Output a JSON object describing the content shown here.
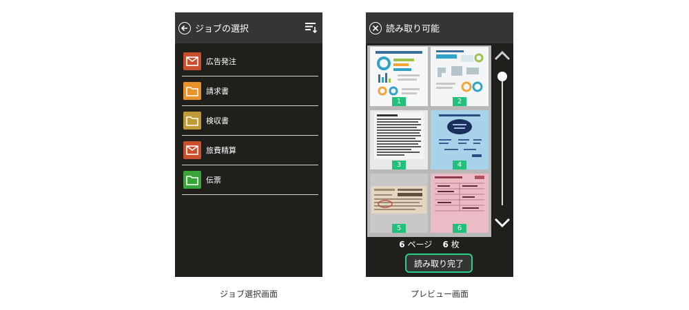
{
  "job_screen": {
    "title": "ジョブの選択",
    "icons": {
      "back": "back-arrow-icon",
      "menu": "sort-menu-icon"
    },
    "jobs": [
      {
        "label": "広告発注",
        "icon": "mail-icon",
        "color": "#c8502e"
      },
      {
        "label": "請求書",
        "icon": "folder-icon",
        "color": "#e8922a"
      },
      {
        "label": "検収書",
        "icon": "folder-icon",
        "color": "#c19a38"
      },
      {
        "label": "旅費精算",
        "icon": "mail-icon",
        "color": "#c8502e"
      },
      {
        "label": "伝票",
        "icon": "folder-icon",
        "color": "#3aa33a"
      }
    ],
    "caption": "ジョブ選択画面"
  },
  "preview_screen": {
    "title": "読み取り可能",
    "icons": {
      "close": "close-icon",
      "up": "chevron-up-icon",
      "down": "chevron-down-icon"
    },
    "pages": [
      "1",
      "2",
      "3",
      "4",
      "5",
      "6"
    ],
    "page_count_num": "6",
    "page_count_unit": "ページ",
    "sheet_count_num": "6",
    "sheet_count_unit": "枚",
    "done_label": "読み取り完了",
    "caption": "プレビュー画面",
    "accent_color": "#24d28c"
  }
}
